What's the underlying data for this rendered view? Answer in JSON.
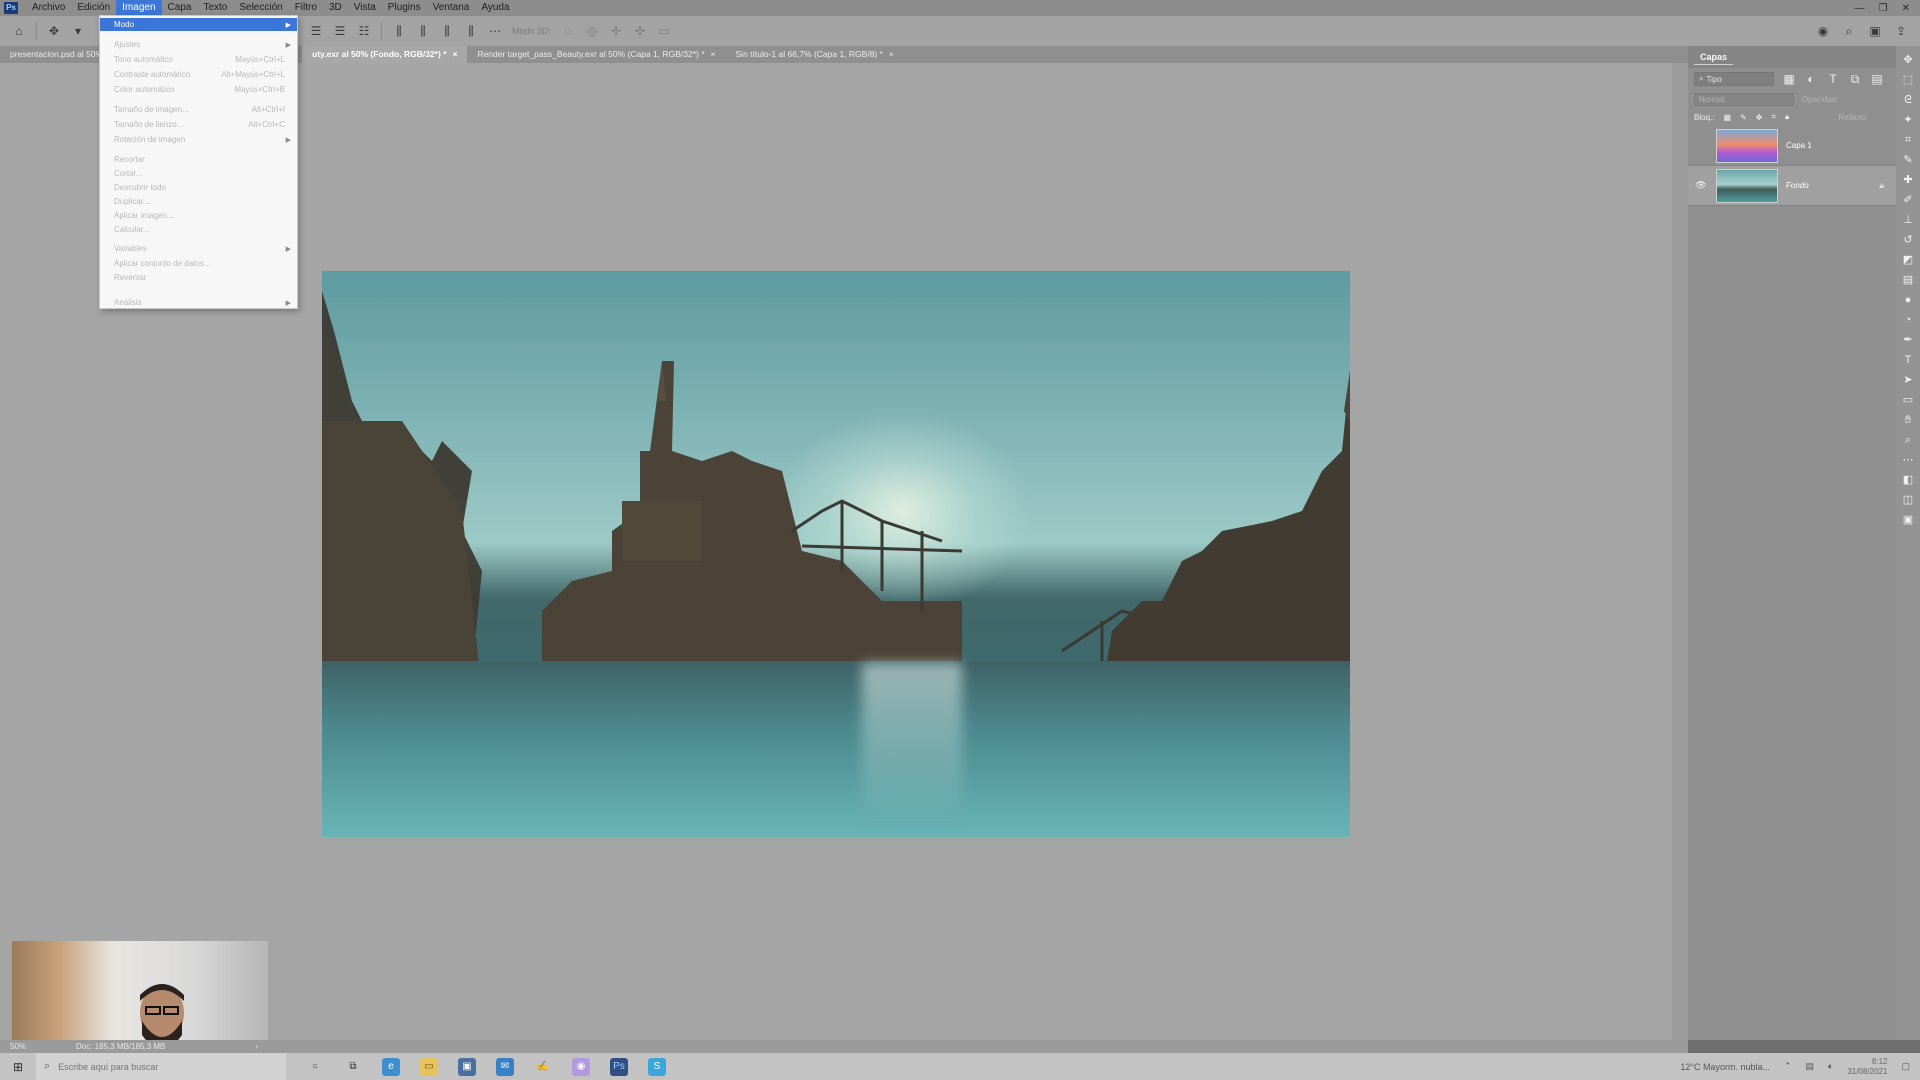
{
  "menubar": {
    "items": [
      {
        "label": "Archivo"
      },
      {
        "label": "Edición"
      },
      {
        "label": "Imagen"
      },
      {
        "label": "Capa"
      },
      {
        "label": "Texto"
      },
      {
        "label": "Selección"
      },
      {
        "label": "Filtro"
      },
      {
        "label": "3D"
      },
      {
        "label": "Vista"
      },
      {
        "label": "Plugins"
      },
      {
        "label": "Ventana"
      },
      {
        "label": "Ayuda"
      }
    ],
    "active_menu": "Imagen"
  },
  "options_bar": {
    "mode3d_label": "Modo 3D:"
  },
  "doc_tabs": [
    {
      "label": "presentacion.psd al 50%",
      "close": "×"
    },
    {
      "label": "uty.exr al 50% (Fondo, RGB/32*) *",
      "close": "×"
    },
    {
      "label": "Render target_pass_Beauty.exr al 50% (Capa 1, RGB/32*) *",
      "close": "×"
    },
    {
      "label": "Sin título-1 al 66,7% (Capa 1, RGB/8) *",
      "close": "×"
    }
  ],
  "active_doc_tab_index": 1,
  "imagen_menu": {
    "items": [
      {
        "label": "Modo",
        "shortcut": "",
        "submenu": true,
        "highlighted": true
      },
      {
        "label": "Ajustes",
        "shortcut": "",
        "submenu": true
      },
      {
        "label": "Tono automático",
        "shortcut": "Mayús+Ctrl+L",
        "submenu": false
      },
      {
        "label": "Contraste automático",
        "shortcut": "Alt+Mayús+Ctrl+L",
        "submenu": false
      },
      {
        "label": "Color automático",
        "shortcut": "Mayús+Ctrl+B",
        "submenu": false
      },
      {
        "label": "Tamaño de imagen...",
        "shortcut": "Alt+Ctrl+I",
        "submenu": false
      },
      {
        "label": "Tamaño de lienzo...",
        "shortcut": "Alt+Ctrl+C",
        "submenu": false
      },
      {
        "label": "Rotación de imagen",
        "shortcut": "",
        "submenu": true
      },
      {
        "label": "Recortar",
        "shortcut": "",
        "submenu": false
      },
      {
        "label": "Cortar...",
        "shortcut": "",
        "submenu": false
      },
      {
        "label": "Descubrir todo",
        "shortcut": "",
        "submenu": false
      },
      {
        "label": "Duplicar...",
        "shortcut": "",
        "submenu": false
      },
      {
        "label": "Aplicar imagen...",
        "shortcut": "",
        "submenu": false
      },
      {
        "label": "Calcular...",
        "shortcut": "",
        "submenu": false
      },
      {
        "label": "Variables",
        "shortcut": "",
        "submenu": true
      },
      {
        "label": "Aplicar conjunto de datos...",
        "shortcut": "",
        "submenu": false
      },
      {
        "label": "Reventar",
        "shortcut": "",
        "submenu": false
      },
      {
        "label": "Análisis",
        "shortcut": "",
        "submenu": true
      }
    ]
  },
  "layers_panel": {
    "tab_label": "Capas",
    "filter_label": "Tipo",
    "blend_mode": "Normal",
    "opacity_label": "Opacidad:",
    "lock_label": "Bloq.:",
    "fill_label": "Relleno:",
    "layers": [
      {
        "name": "Capa 1",
        "visible": false,
        "selected": false,
        "locked": false
      },
      {
        "name": "Fondo",
        "visible": true,
        "selected": true,
        "locked": true
      }
    ]
  },
  "status_bar": {
    "zoom": "50%",
    "doc_info": "Doc: 185,3 MB/185,3 MB"
  },
  "taskbar": {
    "search_placeholder": "Escribe aquí para buscar",
    "weather": "12°C  Mayorm. nubla...",
    "time": "8:12",
    "date": "31/08/2021"
  },
  "colors": {
    "menu_highlight": "#3b76d8",
    "panel_bg": "#8f8f8f",
    "canvas_bg": "#a5a5a5"
  },
  "icons": {
    "home": "home-icon",
    "move": "move-tool-icon",
    "search": "search-icon",
    "eye": "eye-icon",
    "lock": "lock-icon"
  }
}
